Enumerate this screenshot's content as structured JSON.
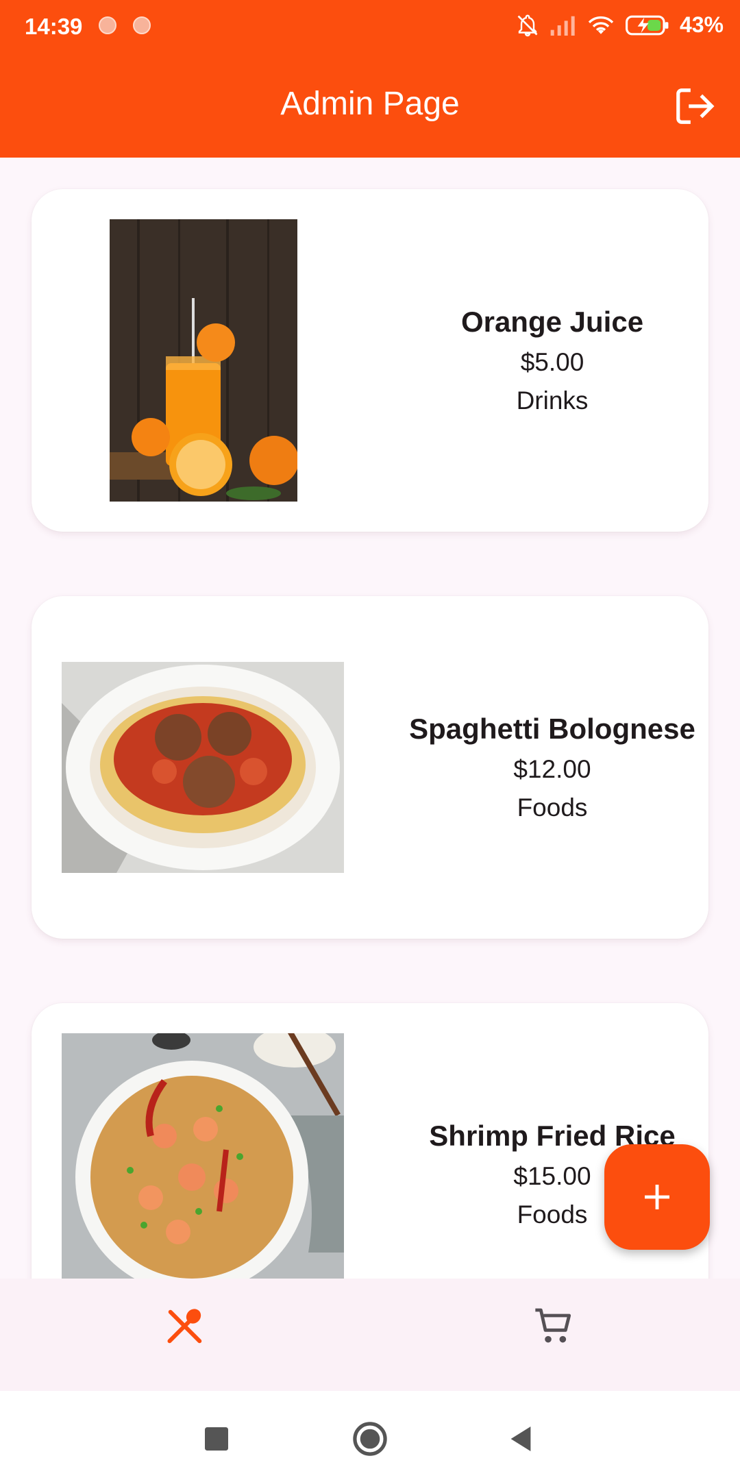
{
  "status_bar": {
    "time": "14:39",
    "battery_percent": "43%",
    "icons": [
      "notifications-off-icon",
      "signal-icon",
      "wifi-icon",
      "battery-charging-icon"
    ]
  },
  "app_bar": {
    "title": "Admin Page",
    "logout_icon": "logout-icon"
  },
  "items": [
    {
      "name": "Orange Juice",
      "price": "$5.00",
      "category": "Drinks",
      "image": "orange-juice-photo"
    },
    {
      "name": "Spaghetti Bolognese",
      "price": "$12.00",
      "category": "Foods",
      "image": "spaghetti-photo"
    },
    {
      "name": "Shrimp Fried Rice",
      "price": "$15.00",
      "category": "Foods",
      "image": "fried-rice-photo"
    }
  ],
  "fab": {
    "icon": "plus-icon"
  },
  "bottom_nav": {
    "items": [
      {
        "icon": "restaurant-icon",
        "active": true
      },
      {
        "icon": "cart-icon",
        "active": false
      }
    ]
  },
  "colors": {
    "primary": "#fc4e0e",
    "background": "#fdf6fb",
    "card": "#ffffff",
    "nav_inactive": "#555055"
  }
}
